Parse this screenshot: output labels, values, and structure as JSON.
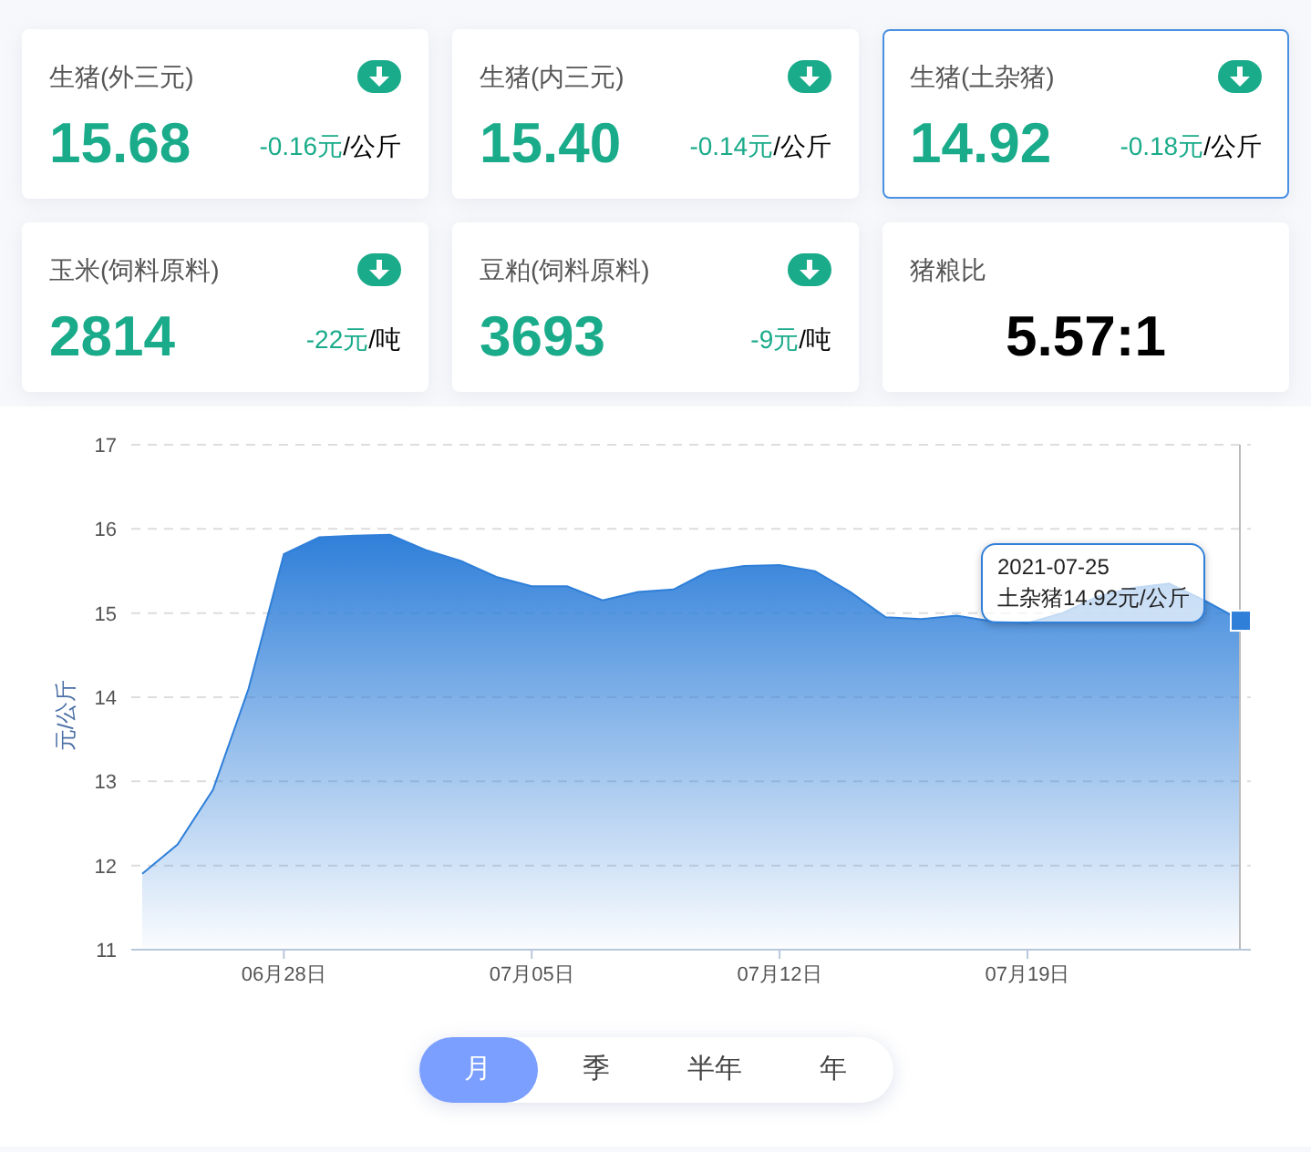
{
  "cards": [
    {
      "kind": "price",
      "title": "生猪(外三元)",
      "value": "15.68",
      "change": "-0.16元",
      "unit": "/公斤",
      "falling": true,
      "selected": false
    },
    {
      "kind": "price",
      "title": "生猪(内三元)",
      "value": "15.40",
      "change": "-0.14元",
      "unit": "/公斤",
      "falling": true,
      "selected": false
    },
    {
      "kind": "price",
      "title": "生猪(土杂猪)",
      "value": "14.92",
      "change": "-0.18元",
      "unit": "/公斤",
      "falling": true,
      "selected": true
    },
    {
      "kind": "price",
      "title": "玉米(饲料原料)",
      "value": "2814",
      "change": "-22元",
      "unit": "/吨",
      "falling": true,
      "selected": false
    },
    {
      "kind": "price",
      "title": "豆粕(饲料原料)",
      "value": "3693",
      "change": "-9元",
      "unit": "/吨",
      "falling": true,
      "selected": false
    },
    {
      "kind": "ratio",
      "title": "猪粮比",
      "value": "5.57:1",
      "selected": false
    }
  ],
  "chart": {
    "chart_data": {
      "type": "area",
      "ylabel": "元/公斤",
      "grid": true,
      "categories": [
        null,
        null,
        null,
        null,
        "06月28日",
        null,
        null,
        null,
        null,
        null,
        null,
        "07月05日",
        null,
        null,
        null,
        null,
        null,
        null,
        "07月12日",
        null,
        null,
        null,
        null,
        null,
        null,
        "07月19日",
        null,
        null,
        null,
        null,
        null,
        null
      ],
      "series": [
        {
          "color": "#2f7fd9",
          "values": [
            11.9,
            12.25,
            12.9,
            14.1,
            15.7,
            15.9,
            15.92,
            15.93,
            15.75,
            15.62,
            15.43,
            15.32,
            15.32,
            15.15,
            15.25,
            15.28,
            15.5,
            15.56,
            15.57,
            15.5,
            15.25,
            14.95,
            14.93,
            14.97,
            14.9,
            14.88,
            15.0,
            15.2,
            15.3,
            15.35,
            15.15,
            14.92
          ]
        }
      ],
      "ylim": [
        11,
        17
      ],
      "yticks": [
        11,
        12,
        13,
        14,
        15,
        16,
        17
      ]
    },
    "tooltip": {
      "date": "2021-07-25",
      "text": "土杂猪14.92元/公斤"
    }
  },
  "periods": [
    {
      "label": "月",
      "selected": true
    },
    {
      "label": "季",
      "selected": false
    },
    {
      "label": "半年",
      "selected": false
    },
    {
      "label": "年",
      "selected": false
    }
  ]
}
